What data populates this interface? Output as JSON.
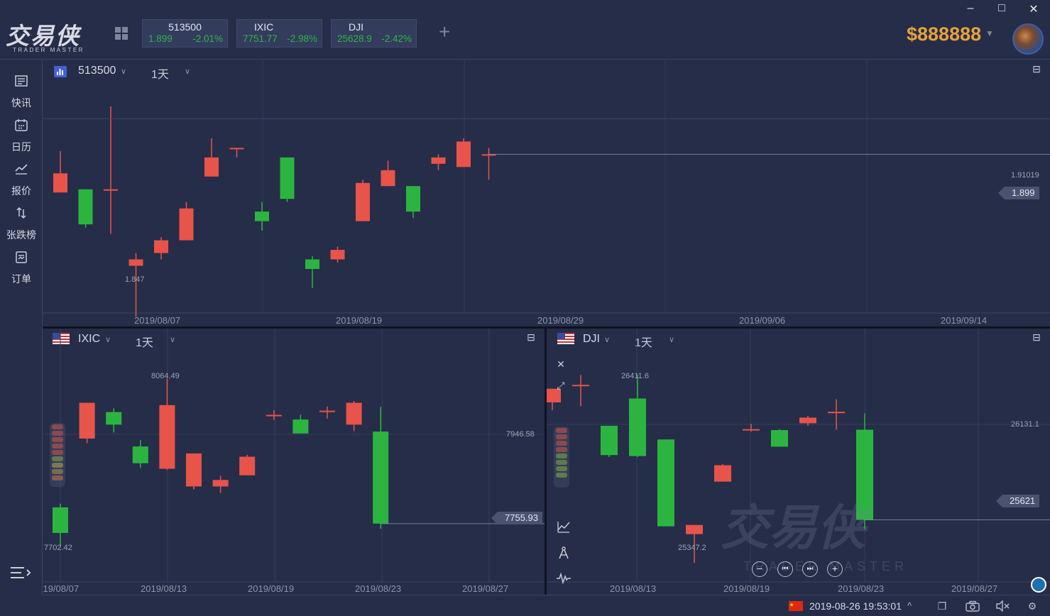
{
  "app": {
    "logo_text": "交易侠",
    "logo_sub": "TRADER MASTER",
    "balance": "$888888"
  },
  "window_controls": {
    "minimize": "–",
    "maximize": "□",
    "close": "✕"
  },
  "ticker_tabs": [
    {
      "name": "513500",
      "price": "1.899",
      "change": "-2.01%"
    },
    {
      "name": "IXIC",
      "price": "7751.77",
      "change": "-2.98%"
    },
    {
      "name": "DJI",
      "price": "25628.9",
      "change": "-2.42%"
    }
  ],
  "sidebar": {
    "items": [
      {
        "label": "快讯",
        "icon": "news-icon"
      },
      {
        "label": "日历",
        "icon": "calendar-icon"
      },
      {
        "label": "报价",
        "icon": "quote-chart-icon"
      },
      {
        "label": "张跌榜",
        "icon": "up-down-arrows-icon"
      },
      {
        "label": "订单",
        "icon": "order-icon"
      }
    ]
  },
  "colors": {
    "up": "#e8534a",
    "down": "#2bb540",
    "accent": "#e6a23c",
    "bg": "#262d48"
  },
  "panels": {
    "top": {
      "symbol": "513500",
      "period": "1天",
      "price_line": "1.91019",
      "last_price": "1.899",
      "low_label": "1.847"
    },
    "left": {
      "symbol": "IXIC",
      "period": "1天",
      "price_line": "7946.58",
      "last_price": "7755.93",
      "high_label": "8064.49",
      "low_label": "7702.42"
    },
    "right": {
      "symbol": "DJI",
      "period": "1天",
      "price_line": "26131.1",
      "last_price": "25621",
      "high_label": "26411.6",
      "low_label": "25347.2"
    }
  },
  "chart_data": [
    {
      "type": "candlestick",
      "symbol": "513500",
      "period": "1天",
      "x_ticks": [
        "2019/08/07",
        "2019/08/19",
        "2019/08/29",
        "2019/09/06",
        "2019/09/14"
      ],
      "candles": [
        {
          "open": 1.887,
          "close": 1.893,
          "high": 1.9,
          "low": 1.887
        },
        {
          "open": 1.888,
          "close": 1.877,
          "high": 1.888,
          "low": 1.876
        },
        {
          "open": 1.888,
          "close": 1.888,
          "high": 1.914,
          "low": 1.874
        },
        {
          "open": 1.864,
          "close": 1.866,
          "high": 1.868,
          "low": 1.848
        },
        {
          "open": 1.868,
          "close": 1.872,
          "high": 1.873,
          "low": 1.866
        },
        {
          "open": 1.872,
          "close": 1.882,
          "high": 1.884,
          "low": 1.872
        },
        {
          "open": 1.892,
          "close": 1.898,
          "high": 1.904,
          "low": 1.892
        },
        {
          "open": 1.901,
          "close": 1.901,
          "high": 1.901,
          "low": 1.898
        },
        {
          "open": 1.881,
          "close": 1.878,
          "high": 1.884,
          "low": 1.875
        },
        {
          "open": 1.898,
          "close": 1.885,
          "high": 1.898,
          "low": 1.884
        },
        {
          "open": 1.866,
          "close": 1.863,
          "high": 1.867,
          "low": 1.857
        },
        {
          "open": 1.866,
          "close": 1.869,
          "high": 1.87,
          "low": 1.865
        },
        {
          "open": 1.878,
          "close": 1.89,
          "high": 1.891,
          "low": 1.878
        },
        {
          "open": 1.889,
          "close": 1.894,
          "high": 1.897,
          "low": 1.889
        },
        {
          "open": 1.889,
          "close": 1.881,
          "high": 1.889,
          "low": 1.879
        },
        {
          "open": 1.896,
          "close": 1.898,
          "high": 1.899,
          "low": 1.894
        },
        {
          "open": 1.895,
          "close": 1.903,
          "high": 1.904,
          "low": 1.895
        },
        {
          "open": 1.899,
          "close": 1.899,
          "high": 1.901,
          "low": 1.891
        }
      ]
    },
    {
      "type": "candlestick",
      "symbol": "IXIC",
      "period": "1天",
      "x_ticks": [
        "2019/08/07",
        "2019/08/13",
        "2019/08/19",
        "2019/08/23",
        "2019/08/27"
      ],
      "candles": [
        {
          "open": 7787,
          "close": 7732,
          "high": 7795,
          "low": 7703
        },
        {
          "open": 7935,
          "close": 8012,
          "high": 8012,
          "low": 7925
        },
        {
          "open": 7992,
          "close": 7965,
          "high": 8000,
          "low": 7948
        },
        {
          "open": 7918,
          "close": 7882,
          "high": 7932,
          "low": 7872
        },
        {
          "open": 7870,
          "close": 8007,
          "high": 8064,
          "low": 7868
        },
        {
          "open": 7832,
          "close": 7903,
          "high": 7903,
          "low": 7826
        },
        {
          "open": 7832,
          "close": 7846,
          "high": 7855,
          "low": 7818
        },
        {
          "open": 7856,
          "close": 7896,
          "high": 7900,
          "low": 7856
        },
        {
          "open": 7986,
          "close": 7986,
          "high": 7996,
          "low": 7975
        },
        {
          "open": 7976,
          "close": 7946,
          "high": 7986,
          "low": 7946
        },
        {
          "open": 7995,
          "close": 7995,
          "high": 8004,
          "low": 7978
        },
        {
          "open": 7965,
          "close": 8012,
          "high": 8016,
          "low": 7951
        },
        {
          "open": 7950,
          "close": 7752,
          "high": 8003,
          "low": 7741
        }
      ]
    },
    {
      "type": "candlestick",
      "symbol": "DJI",
      "period": "1天",
      "x_ticks": [
        "2019/08/13",
        "2019/08/19",
        "2019/08/23",
        "2019/08/27"
      ],
      "candles": [
        {
          "open": 26270,
          "close": 26340,
          "high": 26340,
          "low": 26230
        },
        {
          "open": 26360,
          "close": 26360,
          "high": 26410,
          "low": 26250
        },
        {
          "open": 26150,
          "close": 26000,
          "high": 26150,
          "low": 25990
        },
        {
          "open": 26290,
          "close": 25995,
          "high": 26412,
          "low": 25990
        },
        {
          "open": 26080,
          "close": 25635,
          "high": 26080,
          "low": 25635
        },
        {
          "open": 25595,
          "close": 25642,
          "high": 25642,
          "low": 25447
        },
        {
          "open": 25864,
          "close": 25948,
          "high": 25954,
          "low": 25864
        },
        {
          "open": 26133,
          "close": 26133,
          "high": 26160,
          "low": 26120
        },
        {
          "open": 26128,
          "close": 26043,
          "high": 26133,
          "low": 26043
        },
        {
          "open": 26163,
          "close": 26192,
          "high": 26201,
          "low": 26150
        },
        {
          "open": 26222,
          "close": 26222,
          "high": 26286,
          "low": 26130
        },
        {
          "open": 26130,
          "close": 25668,
          "high": 26213,
          "low": 25621
        }
      ]
    }
  ],
  "watermark": {
    "text": "交易侠",
    "sub": "TRADER MASTER"
  },
  "status": {
    "datetime": "2019-08-26 19:53:01",
    "caret": "^"
  }
}
